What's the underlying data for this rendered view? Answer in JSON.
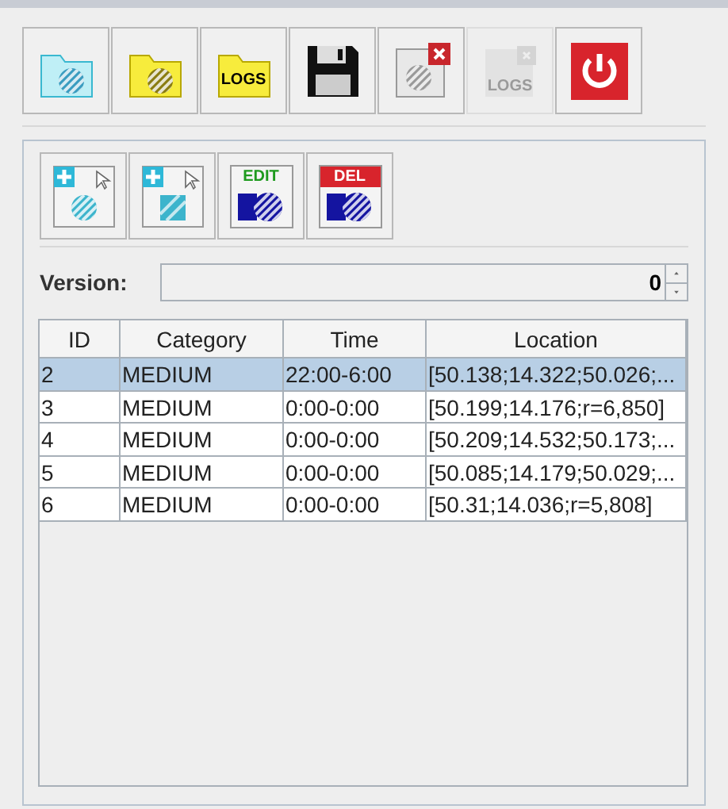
{
  "toolbar": [
    {
      "kind": "cyan-folder",
      "disabled": false
    },
    {
      "kind": "yellow-folder",
      "disabled": false
    },
    {
      "kind": "logs-folder",
      "label": "LOGS",
      "disabled": false
    },
    {
      "kind": "save",
      "disabled": false
    },
    {
      "kind": "delete",
      "disabled": false
    },
    {
      "kind": "delete-logs",
      "label": "LOGS",
      "disabled": true
    },
    {
      "kind": "power",
      "disabled": false
    }
  ],
  "panel_toolbar": [
    {
      "kind": "add-circle"
    },
    {
      "kind": "add-square"
    },
    {
      "kind": "edit",
      "label": "EDIT"
    },
    {
      "kind": "delete",
      "label": "DEL"
    }
  ],
  "version": {
    "label": "Version:",
    "value": "0"
  },
  "table": {
    "columns": [
      "ID",
      "Category",
      "Time",
      "Location"
    ],
    "rows": [
      {
        "cells": [
          "2",
          "MEDIUM",
          "22:00-6:00",
          "[50.138;14.322;50.026;..."
        ],
        "selected": true
      },
      {
        "cells": [
          "3",
          "MEDIUM",
          "0:00-0:00",
          "[50.199;14.176;r=6,850]"
        ],
        "selected": false
      },
      {
        "cells": [
          "4",
          "MEDIUM",
          "0:00-0:00",
          "[50.209;14.532;50.173;..."
        ],
        "selected": false
      },
      {
        "cells": [
          "5",
          "MEDIUM",
          "0:00-0:00",
          "[50.085;14.179;50.029;..."
        ],
        "selected": false
      },
      {
        "cells": [
          "6",
          "MEDIUM",
          "0:00-0:00",
          "[50.31;14.036;r=5,808]"
        ],
        "selected": false
      }
    ]
  }
}
